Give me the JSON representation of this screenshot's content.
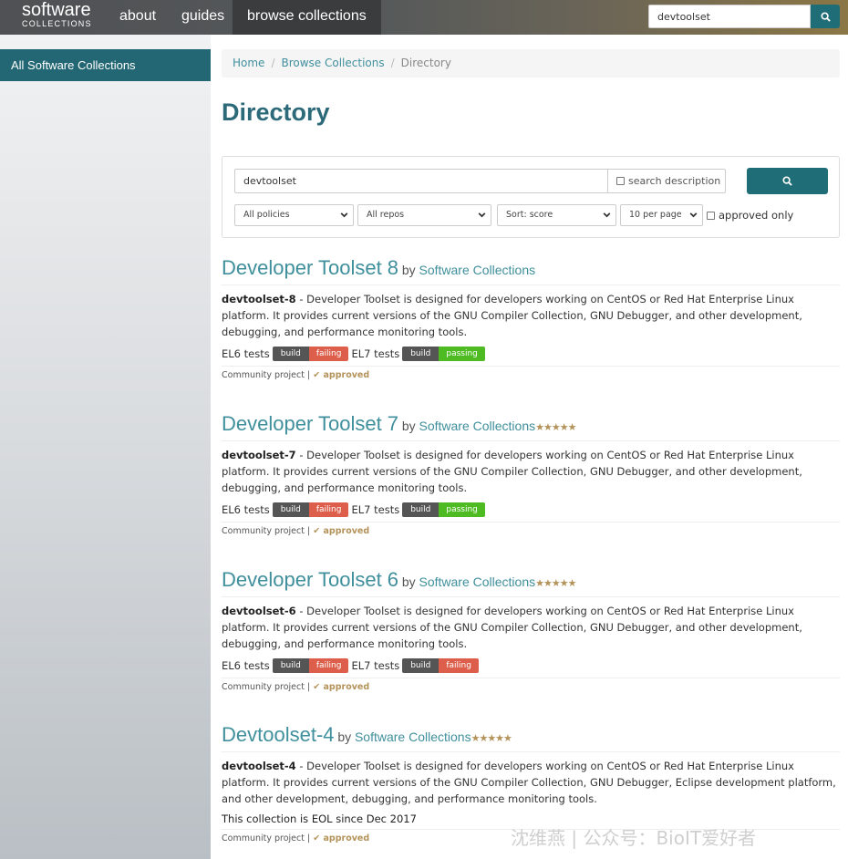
{
  "nav": {
    "logo_top": "software",
    "logo_bottom": "COLLECTIONS",
    "about": "about",
    "guides": "guides",
    "browse": "browse collections",
    "search_value": "devtoolset"
  },
  "sidebar": {
    "item": "All Software Collections"
  },
  "breadcrumb": {
    "home": "Home",
    "browse": "Browse Collections",
    "current": "Directory"
  },
  "page_title": "Directory",
  "search": {
    "query": "devtoolset",
    "desc_label": "search description",
    "policies": "All policies",
    "repos": "All repos",
    "sort": "Sort: score",
    "per_page": "10 per page",
    "approved_only": "approved only"
  },
  "labels": {
    "by": "by",
    "el6": "EL6 tests",
    "el7": "EL7 tests",
    "build": "build",
    "community": "Community project |",
    "approved": "approved",
    "stars": "★★★★★"
  },
  "results": [
    {
      "title": "Developer Toolset 8",
      "owner": "Software Collections",
      "name": "devtoolset-8",
      "desc": " - Developer Toolset is designed for developers working on CentOS or Red Hat Enterprise Linux platform. It provides current versions of the GNU Compiler Collection, GNU Debugger, and other development, debugging, and performance monitoring tools.",
      "el6": "failing",
      "el7": "passing"
    },
    {
      "title": "Developer Toolset 7",
      "owner": "Software Collections",
      "name": "devtoolset-7",
      "desc": " - Developer Toolset is designed for developers working on CentOS or Red Hat Enterprise Linux platform. It provides current versions of the GNU Compiler Collection, GNU Debugger, and other development, debugging, and performance monitoring tools.",
      "el6": "failing",
      "el7": "passing"
    },
    {
      "title": "Developer Toolset 6",
      "owner": "Software Collections",
      "name": "devtoolset-6",
      "desc": " - Developer Toolset is designed for developers working on CentOS or Red Hat Enterprise Linux platform. It provides current versions of the GNU Compiler Collection, GNU Debugger, and other development, debugging, and performance monitoring tools.",
      "el6": "failing",
      "el7": "failing"
    },
    {
      "title": "Devtoolset-4",
      "owner": "Software Collections",
      "name": "devtoolset-4",
      "desc": " - Developer Toolset is designed for developers working on CentOS or Red Hat Enterprise Linux platform. It provides current versions of the GNU Compiler Collection, GNU Debugger, Eclipse development platform, and other development, debugging, and performance monitoring tools.",
      "eol": "This collection is EOL since Dec 2017"
    }
  ],
  "watermark": "沈维燕 | 公众号：BioIT爱好者",
  "colors": {
    "accent": "#1f6d77",
    "link": "#3f8f9c",
    "failing": "#dd5f4b",
    "passing": "#4dbb21",
    "star": "#b4935a"
  }
}
